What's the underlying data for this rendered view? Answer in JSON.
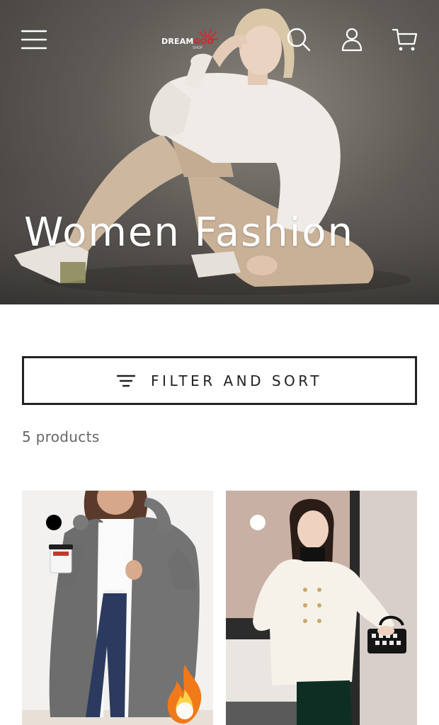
{
  "header": {
    "menu_icon": "hamburger-menu-icon",
    "search_icon": "search-icon",
    "account_icon": "account-icon",
    "cart_icon": "cart-icon",
    "logo": {
      "text_primary": "DREAM",
      "text_accent": "GOO",
      "tagline": "SHOP"
    }
  },
  "hero": {
    "title": "Women Fashion"
  },
  "filter": {
    "label": "FILTER AND SORT",
    "icon": "filter-icon"
  },
  "results": {
    "count_text": "5 products"
  },
  "products": [
    {
      "swatches": [
        "#000000",
        "#7a7a7a"
      ],
      "badge_icon": "fire-icon"
    },
    {
      "swatches": [
        "#ffffff"
      ]
    }
  ],
  "colors": {
    "accent": "#d92328",
    "text": "#222222",
    "muted": "#666666"
  }
}
